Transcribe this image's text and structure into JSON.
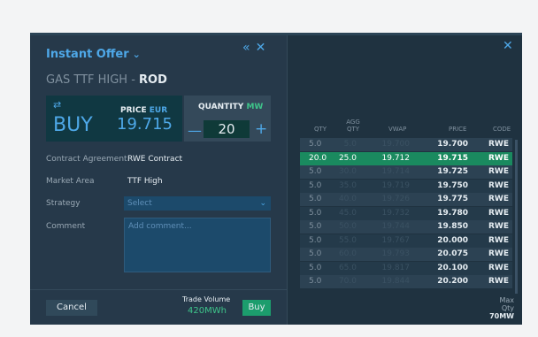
{
  "header": {
    "title": "Instant Offer",
    "collapse_icon": "double-chevron-left-icon",
    "close_icon": "close-icon"
  },
  "product": {
    "prefix": "GAS TTF HIGH - ",
    "name": "ROD"
  },
  "side": {
    "label": "BUY",
    "icon": "swap-arrows-icon"
  },
  "price": {
    "label": "PRICE",
    "unit": "EUR",
    "value": "19.715"
  },
  "quantity": {
    "label": "QUANTITY",
    "unit": "MW",
    "value": "20"
  },
  "fields": {
    "contract_agreement": {
      "label": "Contract Agreement",
      "value": "RWE Contract"
    },
    "market_area": {
      "label": "Market Area",
      "value": "TTF High"
    },
    "strategy": {
      "label": "Strategy",
      "placeholder": "Select"
    },
    "comment": {
      "label": "Comment",
      "placeholder": "Add comment..."
    }
  },
  "footer": {
    "cancel_label": "Cancel",
    "trade_volume_label": "Trade Volume",
    "trade_volume_value": "420MWh",
    "buy_label": "Buy"
  },
  "orderbook": {
    "columns": [
      "QTY",
      "AGG QTY",
      "VWAP",
      "PRICE",
      "CODE"
    ],
    "rows": [
      {
        "qty": "5.0",
        "agg": "5.0",
        "vwap": "19.700",
        "price": "19.700",
        "code": "RWE"
      },
      {
        "qty": "20.0",
        "agg": "25.0",
        "vwap": "19.712",
        "price": "19.715",
        "code": "RWE",
        "highlight": true
      },
      {
        "qty": "5.0",
        "agg": "30.0",
        "vwap": "19.714",
        "price": "19.725",
        "code": "RWE"
      },
      {
        "qty": "5.0",
        "agg": "35.0",
        "vwap": "19.719",
        "price": "19.750",
        "code": "RWE"
      },
      {
        "qty": "5.0",
        "agg": "40.0",
        "vwap": "19.726",
        "price": "19.775",
        "code": "RWE"
      },
      {
        "qty": "5.0",
        "agg": "45.0",
        "vwap": "19.732",
        "price": "19.780",
        "code": "RWE"
      },
      {
        "qty": "5.0",
        "agg": "50.0",
        "vwap": "19.744",
        "price": "19.850",
        "code": "RWE"
      },
      {
        "qty": "5.0",
        "agg": "55.0",
        "vwap": "19.767",
        "price": "20.000",
        "code": "RWE"
      },
      {
        "qty": "5.0",
        "agg": "60.0",
        "vwap": "19.793",
        "price": "20.075",
        "code": "RWE"
      },
      {
        "qty": "5.0",
        "agg": "65.0",
        "vwap": "19.817",
        "price": "20.100",
        "code": "RWE"
      },
      {
        "qty": "5.0",
        "agg": "70.0",
        "vwap": "19.844",
        "price": "20.200",
        "code": "RWE"
      }
    ],
    "max_qty_label": "Max Qty",
    "max_qty_value": "70MW",
    "close_icon": "close-icon"
  },
  "colors": {
    "accent": "#4ea8e8",
    "buy_green": "#1c9d6d",
    "highlight_row": "#1a8a5f",
    "panel": "#26394a"
  }
}
